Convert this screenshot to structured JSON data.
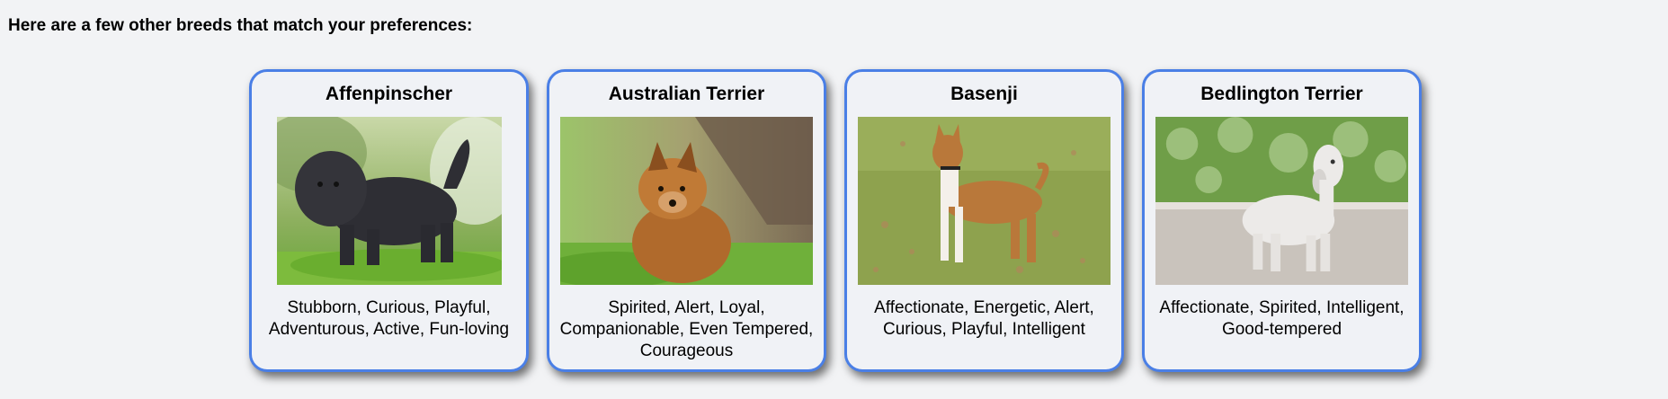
{
  "heading": "Here are a few other breeds that match your preferences:",
  "breeds": [
    {
      "name": "Affenpinscher",
      "traits": "Stubborn, Curious, Playful, Adventurous, Active, Fun-loving",
      "image_icon": "affenpinscher-photo"
    },
    {
      "name": "Australian Terrier",
      "traits": "Spirited, Alert, Loyal, Companionable, Even Tempered, Courageous",
      "image_icon": "australian-terrier-photo"
    },
    {
      "name": "Basenji",
      "traits": "Affectionate, Energetic, Alert, Curious, Playful, Intelligent",
      "image_icon": "basenji-photo"
    },
    {
      "name": "Bedlington Terrier",
      "traits": "Affectionate, Spirited, Intelligent, Good-tempered",
      "image_icon": "bedlington-terrier-photo"
    }
  ],
  "colors": {
    "card_border": "#4a7fe6",
    "card_background": "#f0f2f6",
    "page_background": "#f2f3f5"
  }
}
